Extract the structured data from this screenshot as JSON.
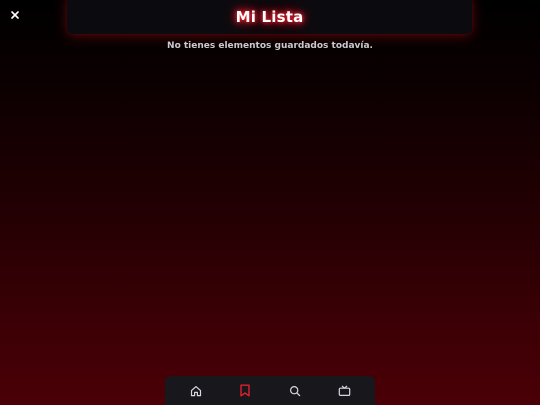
{
  "header": {
    "title": "Mi Lista"
  },
  "main": {
    "empty_message": "No tienes elementos guardados todavía."
  },
  "close_button": {
    "icon": "close-icon"
  },
  "bottom_nav": {
    "items": [
      {
        "id": "home",
        "icon": "home-icon",
        "active": false
      },
      {
        "id": "my-list",
        "icon": "bookmark-icon",
        "active": true
      },
      {
        "id": "search",
        "icon": "search-icon",
        "active": false
      },
      {
        "id": "tv",
        "icon": "tv-icon",
        "active": false
      }
    ]
  },
  "colors": {
    "accent": "#e0202e",
    "icon_inactive": "#d8d8de",
    "nav_background": "#17171c",
    "header_background": "#0b0b0f",
    "title_glow": "#ff1a2a",
    "message_text": "#c9c9cf"
  }
}
